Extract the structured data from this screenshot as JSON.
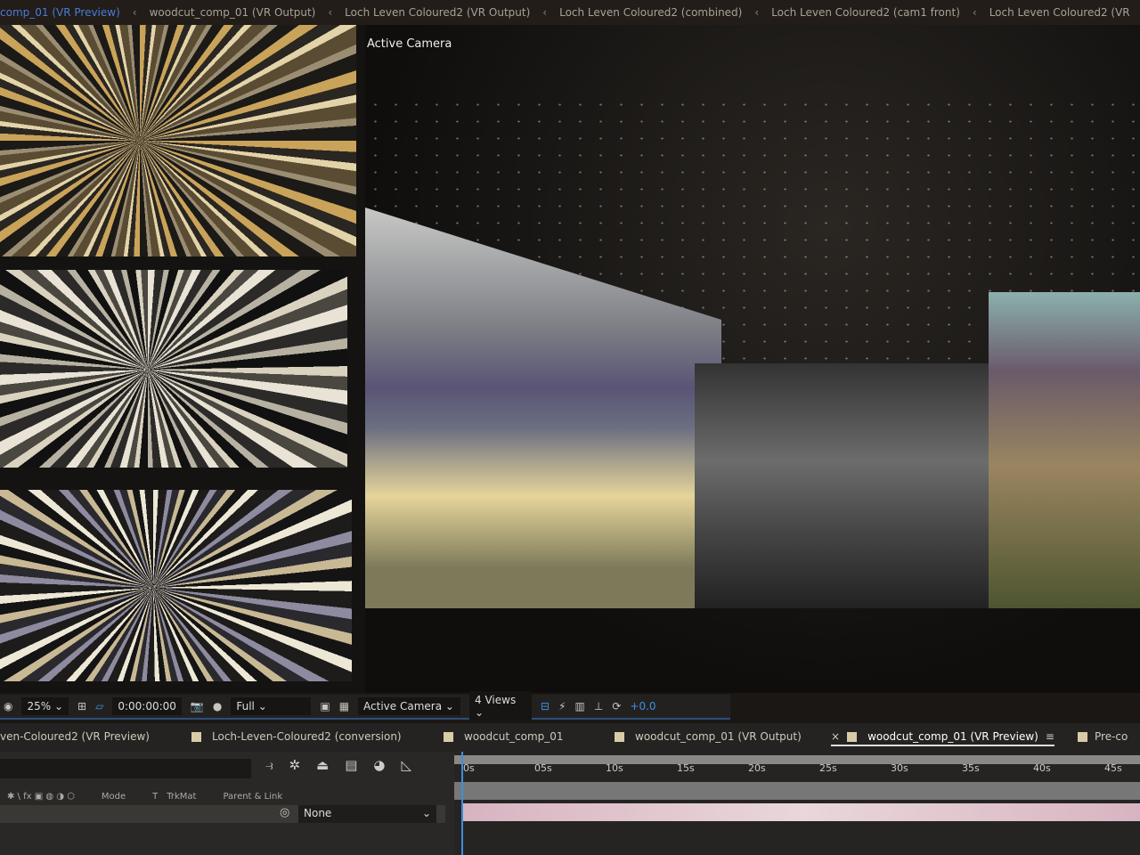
{
  "breadcrumbs": [
    "comp_01 (VR Preview)",
    "woodcut_comp_01 (VR Output)",
    "Loch Leven Coloured2 (VR Output)",
    "Loch Leven Coloured2 (combined)",
    "Loch Leven Coloured2 (cam1 front)",
    "Loch Leven Coloured2 (VR"
  ],
  "viewer": {
    "label": "Active Camera"
  },
  "toolbar": {
    "zoom": "25%",
    "timecode": "0:00:00:00",
    "resolution": "Full",
    "camera": "Active Camera",
    "views": "4 Views",
    "exposure": "+0.0"
  },
  "tabs": [
    {
      "label": "ven-Coloured2 (VR Preview)"
    },
    {
      "label": "Loch-Leven-Coloured2 (conversion)"
    },
    {
      "label": "woodcut_comp_01"
    },
    {
      "label": "woodcut_comp_01 (VR Output)"
    },
    {
      "label": "woodcut_comp_01 (VR Preview)",
      "active": true
    },
    {
      "label": "Pre-co"
    }
  ],
  "timeline": {
    "ticks": [
      "0s",
      "05s",
      "10s",
      "15s",
      "20s",
      "25s",
      "30s",
      "35s",
      "40s",
      "45s"
    ],
    "columns": {
      "mode": "Mode",
      "t": "T",
      "trkmat": "TrkMat",
      "parent": "Parent & Link"
    },
    "parent_value": "None"
  },
  "colors": {
    "accent": "#3d8ee0",
    "tab_swatch": "#d8cca8"
  }
}
